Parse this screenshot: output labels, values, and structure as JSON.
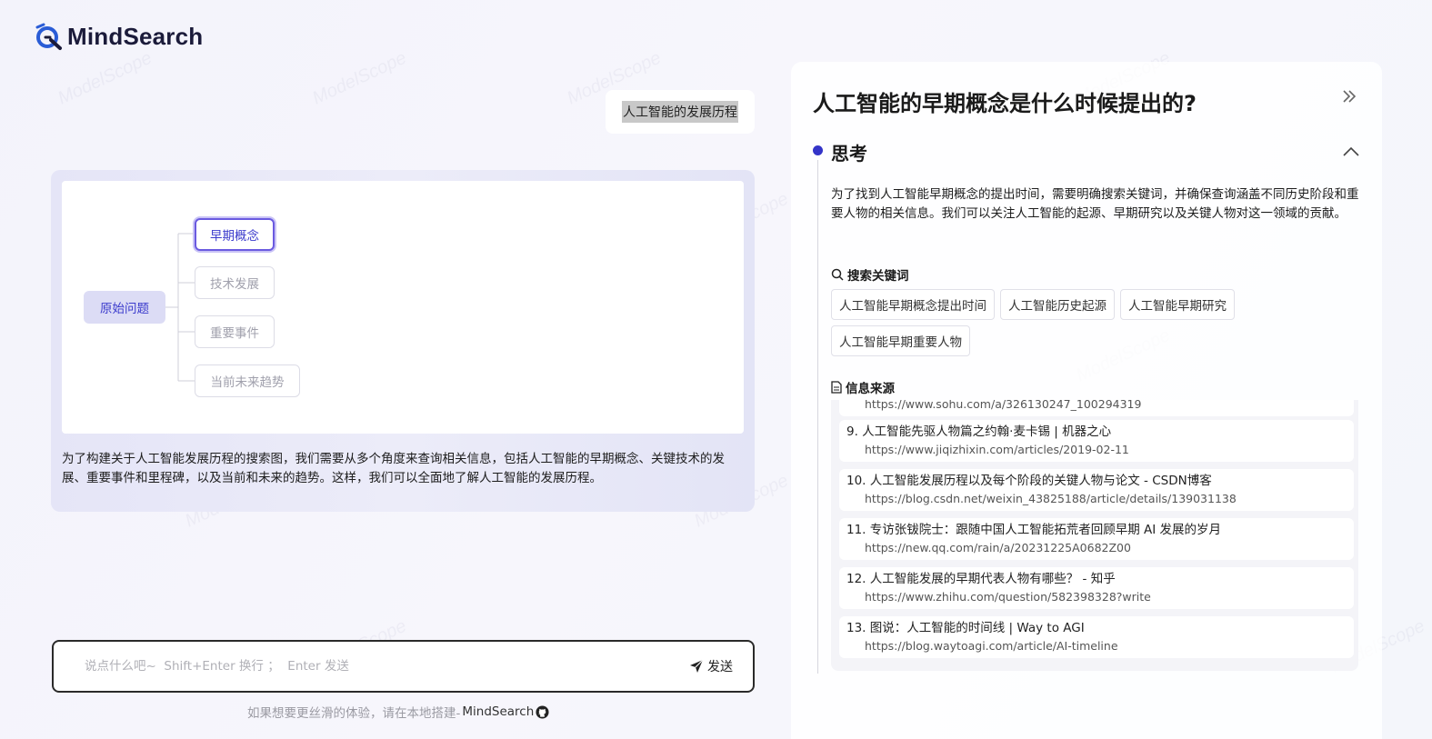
{
  "app": {
    "name": "MindSearch"
  },
  "conversation": {
    "user_message": "人工智能的发展历程",
    "graph": {
      "root": "原始问题",
      "children": [
        "早期概念",
        "技术发展",
        "重要事件",
        "当前未来趋势"
      ],
      "active_child": "早期概念"
    },
    "answer": "为了构建关于人工智能发展历程的搜索图，我们需要从多个角度来查询相关信息，包括人工智能的早期概念、关键技术的发展、重要事件和里程碑，以及当前和未来的趋势。这样，我们可以全面地了解人工智能的发展历程。"
  },
  "input": {
    "placeholder": "说点什么吧~  Shift+Enter 换行 ；  Enter 发送",
    "value": "",
    "send_label": "发送"
  },
  "footer": {
    "note": "如果想要更丝滑的体验，请在本地搭建-",
    "brand": "MindSearch"
  },
  "panel": {
    "title": "人工智能的早期概念是什么时候提出的?",
    "think_title": "思考",
    "think_text": "为了找到人工智能早期概念的提出时间，需要明确搜索关键词，并确保查询涵盖不同历史阶段和重要人物的相关信息。我们可以关注人工智能的起源、早期研究以及关键人物对这一领域的贡献。",
    "keywords_label": "搜索关键词",
    "keywords": [
      "人工智能早期概念提出时间",
      "人工智能历史起源",
      "人工智能早期研究",
      "人工智能早期重要人物"
    ],
    "sources_label": "信息来源",
    "partial_source_url": "https://www.sohu.com/a/326130247_100294319",
    "sources": [
      {
        "title": "9. 人工智能先驱人物篇之约翰·麦卡锡 | 机器之心",
        "url": "https://www.jiqizhixin.com/articles/2019-02-11"
      },
      {
        "title": "10. 人工智能发展历程以及每个阶段的关键人物与论文 - CSDN博客",
        "url": "https://blog.csdn.net/weixin_43825188/article/details/139031138"
      },
      {
        "title": "11. 专访张钹院士：跟随中国人工智能拓荒者回顾早期 AI 发展的岁月",
        "url": "https://new.qq.com/rain/a/20231225A0682Z00"
      },
      {
        "title": "12. 人工智能发展的早期代表人物有哪些？ - 知乎",
        "url": "https://www.zhihu.com/question/582398328?write"
      },
      {
        "title": "13. 图说：人工智能的时间线 | Way to AGI",
        "url": "https://blog.waytoagi.com/article/AI-timeline"
      }
    ]
  },
  "colors": {
    "accent": "#3434c8",
    "active_node_border": "#6a5ae0",
    "card_bg": "#e8e8f8"
  }
}
